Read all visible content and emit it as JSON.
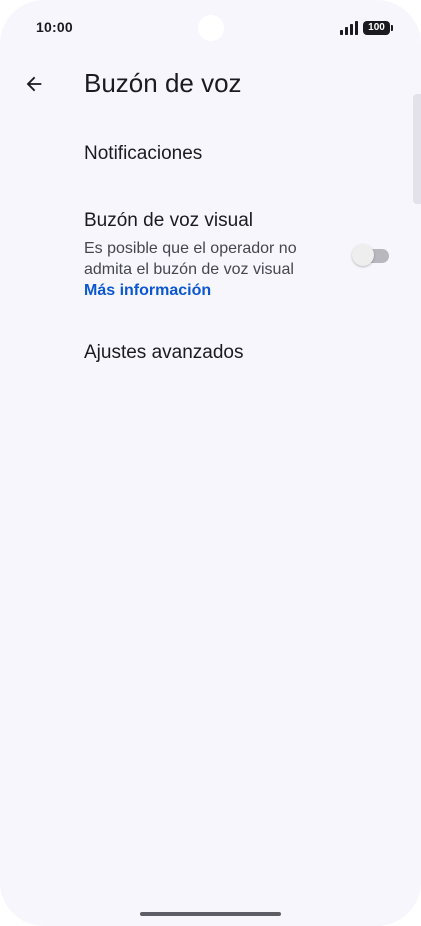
{
  "status_bar": {
    "time": "10:00",
    "battery": "100",
    "icons": [
      "signal-icon",
      "battery-icon"
    ]
  },
  "app_bar": {
    "back_icon": "arrow-back-icon",
    "title": "Buzón de voz"
  },
  "items": {
    "notifications": {
      "title": "Notificaciones"
    },
    "visual_voicemail": {
      "title": "Buzón de voz visual",
      "summary": "Es posible que el operador no admita el buzón de voz visual",
      "link": "Más información",
      "toggle_on": false
    },
    "advanced": {
      "title": "Ajustes avanzados"
    }
  },
  "colors": {
    "background": "#f8f6fd",
    "text": "#1b1b1f",
    "link": "#0b57d0"
  }
}
